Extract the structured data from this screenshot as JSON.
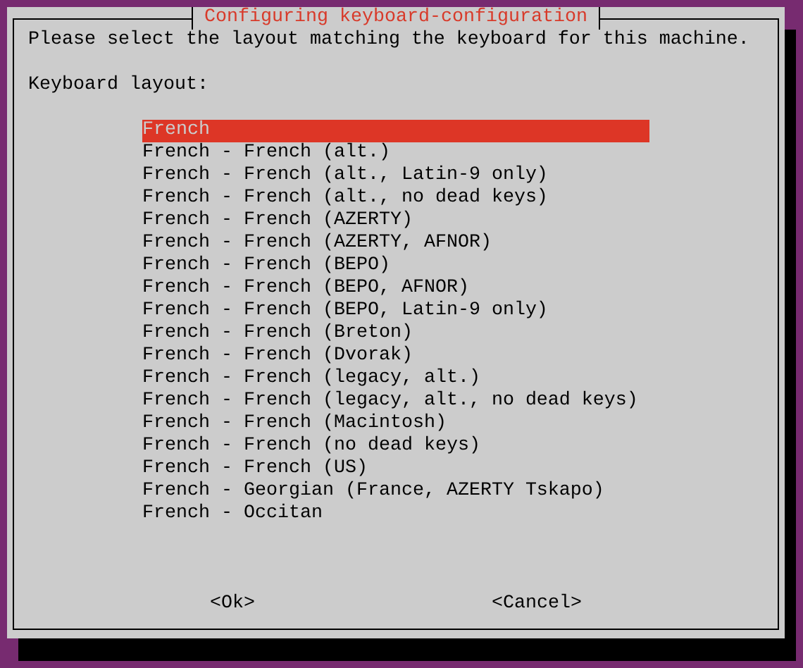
{
  "dialog": {
    "title": "Configuring keyboard-configuration",
    "prompt": "Please select the layout matching the keyboard for this machine.",
    "list_label": "Keyboard layout:",
    "items": [
      {
        "label": "French",
        "selected": true
      },
      {
        "label": "French - French (alt.)",
        "selected": false
      },
      {
        "label": "French - French (alt., Latin-9 only)",
        "selected": false
      },
      {
        "label": "French - French (alt., no dead keys)",
        "selected": false
      },
      {
        "label": "French - French (AZERTY)",
        "selected": false
      },
      {
        "label": "French - French (AZERTY, AFNOR)",
        "selected": false
      },
      {
        "label": "French - French (BEPO)",
        "selected": false
      },
      {
        "label": "French - French (BEPO, AFNOR)",
        "selected": false
      },
      {
        "label": "French - French (BEPO, Latin-9 only)",
        "selected": false
      },
      {
        "label": "French - French (Breton)",
        "selected": false
      },
      {
        "label": "French - French (Dvorak)",
        "selected": false
      },
      {
        "label": "French - French (legacy, alt.)",
        "selected": false
      },
      {
        "label": "French - French (legacy, alt., no dead keys)",
        "selected": false
      },
      {
        "label": "French - French (Macintosh)",
        "selected": false
      },
      {
        "label": "French - French (no dead keys)",
        "selected": false
      },
      {
        "label": "French - French (US)",
        "selected": false
      },
      {
        "label": "French - Georgian (France, AZERTY Tskapo)",
        "selected": false
      },
      {
        "label": "French - Occitan",
        "selected": false
      }
    ],
    "buttons": [
      "<Ok>",
      "<Cancel>"
    ]
  }
}
